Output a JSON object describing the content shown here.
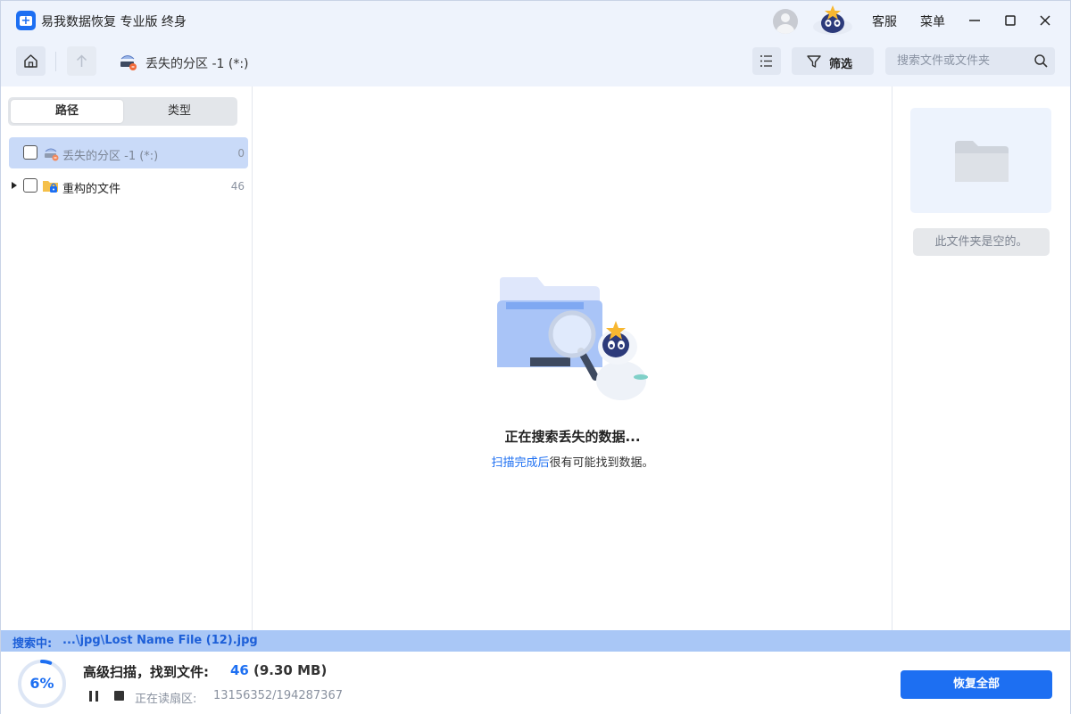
{
  "app": {
    "title": "易我数据恢复 专业版 终身",
    "support_label": "客服",
    "menu_label": "菜单"
  },
  "toolbar": {
    "breadcrumb": "丢失的分区 -1 (*:)",
    "filter_label": "筛选",
    "search_placeholder": "搜索文件或文件夹"
  },
  "sidebar": {
    "tabs": [
      {
        "label": "路径",
        "active": true
      },
      {
        "label": "类型",
        "active": false
      }
    ],
    "items": [
      {
        "label": "丢失的分区 -1 (*:)",
        "count": "0",
        "selected": true,
        "icon": "drive-lost-icon"
      },
      {
        "label": "重构的文件",
        "count": "46",
        "selected": false,
        "icon": "folder-lock-icon"
      }
    ]
  },
  "main": {
    "searching_title": "正在搜索丢失的数据...",
    "hint_link": "扫描完成后",
    "hint_text": "很有可能找到数据。"
  },
  "preview": {
    "empty_text": "此文件夹是空的。"
  },
  "status": {
    "label": "搜索中:",
    "path": "...\\jpg\\Lost Name File (12).jpg"
  },
  "scan": {
    "progress_text": "6%",
    "progress_value": 0.06,
    "title": "高级扫描，找到文件:",
    "count": "46",
    "size": "(9.30 MB)",
    "reading_label": "正在读扇区:",
    "reading_value": "13156352/194287367",
    "recover_all": "恢复全部"
  },
  "colors": {
    "accent": "#1d6ff2",
    "titlebar_bg": "#eef3fc",
    "status_strip": "#a9c7f6",
    "selection": "#c9daf8"
  }
}
